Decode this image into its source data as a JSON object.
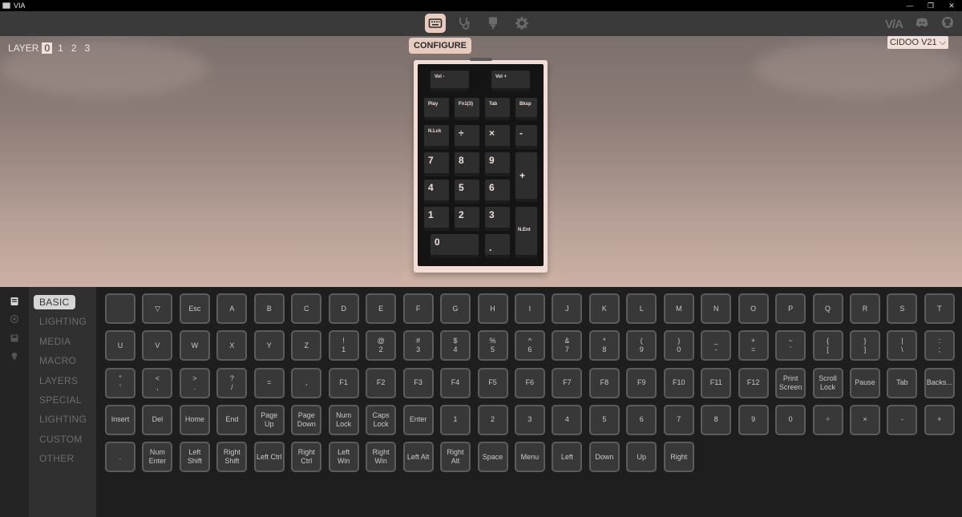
{
  "window": {
    "title": "VIA",
    "controls": [
      "—",
      "❐",
      "✕"
    ]
  },
  "toolbar": {
    "nav": [
      {
        "name": "configure",
        "icon": "keyboard-icon",
        "active": true
      },
      {
        "name": "test",
        "icon": "stethoscope-icon",
        "active": false
      },
      {
        "name": "design",
        "icon": "design-icon",
        "active": false
      },
      {
        "name": "settings",
        "icon": "gear-icon",
        "active": false
      }
    ],
    "tooltip": "CONFIGURE",
    "logo": "V/A"
  },
  "layer": {
    "label": "LAYER",
    "options": [
      "0",
      "1",
      "2",
      "3"
    ],
    "selected": "0"
  },
  "device": {
    "name": "CIDOO V21",
    "chevron": "⌵"
  },
  "keyboard": {
    "case_color": "#f1ddd5",
    "keys": [
      {
        "label": "Vol -"
      },
      {
        "label": "Vol +"
      },
      {
        "label": "Play"
      },
      {
        "label": "Fn1(3)"
      },
      {
        "label": "Tab"
      },
      {
        "label": "Bksp"
      },
      {
        "label": "N.Lck"
      },
      {
        "label": "÷"
      },
      {
        "label": "×"
      },
      {
        "label": "-"
      },
      {
        "label": "7"
      },
      {
        "label": "8"
      },
      {
        "label": "9"
      },
      {
        "label": "+"
      },
      {
        "label": "4"
      },
      {
        "label": "5"
      },
      {
        "label": "6"
      },
      {
        "label": "1"
      },
      {
        "label": "2"
      },
      {
        "label": "3"
      },
      {
        "label": "N.Ent"
      },
      {
        "label": "0"
      },
      {
        "label": "."
      }
    ]
  },
  "categories": [
    {
      "label": "BASIC",
      "active": true
    },
    {
      "label": "LIGHTING",
      "active": false
    },
    {
      "label": "MEDIA",
      "active": false
    },
    {
      "label": "MACRO",
      "active": false
    },
    {
      "label": "LAYERS",
      "active": false
    },
    {
      "label": "SPECIAL",
      "active": false
    },
    {
      "label": "LIGHTING",
      "active": false
    },
    {
      "label": "CUSTOM",
      "active": false
    },
    {
      "label": "OTHER",
      "active": false
    }
  ],
  "palette": [
    [
      "",
      "▽",
      "Esc",
      "A",
      "B",
      "C",
      "D",
      "E",
      "F",
      "G",
      "H",
      "I",
      "J",
      "K",
      "L",
      "M",
      "N",
      "O",
      "P",
      "Q",
      "R",
      "S",
      "T"
    ],
    [
      "U",
      "V",
      "W",
      "X",
      "Y",
      "Z",
      "!\n1",
      "@\n2",
      "#\n3",
      "$\n4",
      "%\n5",
      "^\n6",
      "&\n7",
      "*\n8",
      "(\n9",
      ")\n0",
      "_\n-",
      "+\n=",
      "~\n`",
      "{\n[",
      "}\n]",
      "|\n\\",
      ":\n;"
    ],
    [
      "\"\n'",
      "<\n,",
      ">\n.",
      "?\n/",
      "=",
      ",",
      "F1",
      "F2",
      "F3",
      "F4",
      "F5",
      "F6",
      "F7",
      "F8",
      "F9",
      "F10",
      "F11",
      "F12",
      "Print\nScreen",
      "Scroll\nLock",
      "Pause",
      "Tab",
      "Backs..."
    ],
    [
      "Insert",
      "Del",
      "Home",
      "End",
      "Page\nUp",
      "Page\nDown",
      "Num\nLock",
      "Caps\nLock",
      "Enter",
      "1",
      "2",
      "3",
      "4",
      "5",
      "6",
      "7",
      "8",
      "9",
      "0",
      "÷",
      "×",
      "-",
      "+"
    ],
    [
      ".",
      "Num\nEnter",
      "Left\nShift",
      "Right\nShift",
      "Left Ctrl",
      "Right\nCtrl",
      "Left\nWin",
      "Right\nWin",
      "Left Alt",
      "Right\nAlt",
      "Space",
      "Menu",
      "Left",
      "Down",
      "Up",
      "Right"
    ]
  ]
}
